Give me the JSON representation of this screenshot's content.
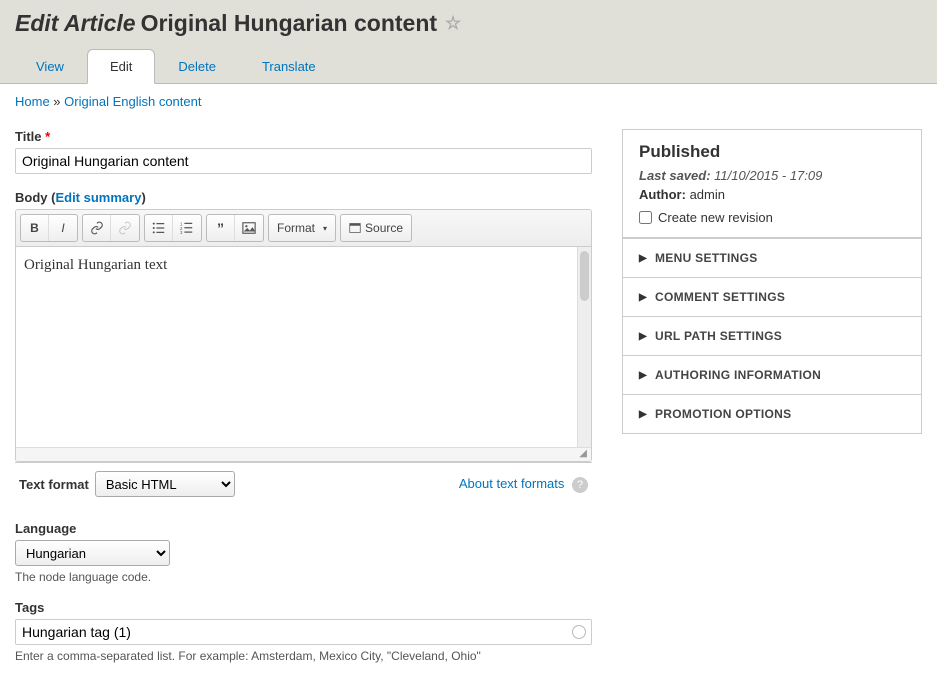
{
  "header": {
    "title_prefix": "Edit Article",
    "title_name": "Original Hungarian content"
  },
  "tabs": {
    "view": "View",
    "edit": "Edit",
    "delete": "Delete",
    "translate": "Translate"
  },
  "breadcrumb": {
    "home": "Home",
    "sep": " » ",
    "current": "Original English content"
  },
  "form": {
    "title_label": "Title",
    "title_value": "Original Hungarian content",
    "body_label": "Body",
    "body_summary_link": "Edit summary",
    "body_content": "Original Hungarian text",
    "format_btn": "Format",
    "source_btn": "Source",
    "text_format_label": "Text format",
    "text_format_value": "Basic HTML",
    "about_formats": "About text formats",
    "language_label": "Language",
    "language_value": "Hungarian",
    "language_desc": "The node language code.",
    "tags_label": "Tags",
    "tags_value": "Hungarian tag (1)",
    "tags_desc": "Enter a comma-separated list. For example: Amsterdam, Mexico City, \"Cleveland, Ohio\""
  },
  "sidebar": {
    "status": "Published",
    "last_saved_label": "Last saved:",
    "last_saved_value": "11/10/2015 - 17:09",
    "author_label": "Author:",
    "author_value": "admin",
    "revision_label": "Create new revision",
    "sections": {
      "menu": "MENU SETTINGS",
      "comment": "COMMENT SETTINGS",
      "url": "URL PATH SETTINGS",
      "authoring": "AUTHORING INFORMATION",
      "promotion": "PROMOTION OPTIONS"
    }
  }
}
